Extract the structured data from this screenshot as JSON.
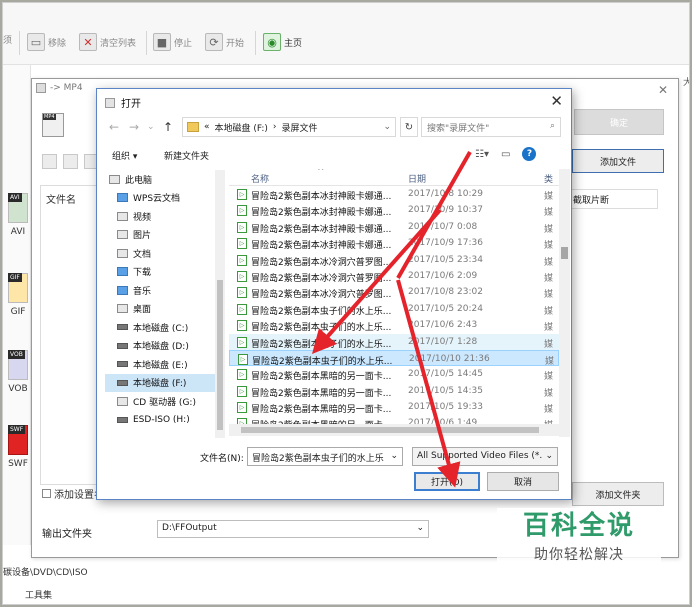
{
  "app": {
    "toolbar": {
      "left_fragment": "须",
      "remove": "移除",
      "clear_list": "清空列表",
      "stop": "停止",
      "start": "开始",
      "home": "主页"
    },
    "formats": [
      "AVI",
      "GIF",
      "VOB",
      "SWF"
    ],
    "format_tags": [
      "AVI",
      "GIF",
      "VOB",
      "SWF"
    ],
    "bottom_text": "碳设备\\DVD\\CD\\ISO",
    "toolbox": "工具集",
    "right_edge": "大"
  },
  "mp4_dialog": {
    "title": "-> MP4",
    "ok": "确定",
    "add_file": "添加文件",
    "file_name_col": "文件名",
    "clip": "截取片断",
    "add_settings": "添加设置名",
    "add_folder": "添加文件夹",
    "output_label": "输出文件夹",
    "output_path": "D:\\FFOutput"
  },
  "open_dialog": {
    "title": "打开",
    "breadcrumb": [
      "«",
      "本地磁盘 (F:)",
      "›",
      "录屏文件"
    ],
    "search_placeholder": "搜索\"录屏文件\"",
    "organize": "组织 ▾",
    "new_folder": "新建文件夹",
    "nav": [
      {
        "label": "此电脑",
        "icon": "pc-icon"
      },
      {
        "label": "WPS云文档",
        "icon": "cloud-icon"
      },
      {
        "label": "视频",
        "icon": "video-icon"
      },
      {
        "label": "图片",
        "icon": "picture-icon"
      },
      {
        "label": "文档",
        "icon": "document-icon"
      },
      {
        "label": "下载",
        "icon": "download-icon"
      },
      {
        "label": "音乐",
        "icon": "music-icon"
      },
      {
        "label": "桌面",
        "icon": "desktop-icon"
      },
      {
        "label": "本地磁盘 (C:)",
        "icon": "drive-icon"
      },
      {
        "label": "本地磁盘 (D:)",
        "icon": "drive-icon"
      },
      {
        "label": "本地磁盘 (E:)",
        "icon": "drive-icon"
      },
      {
        "label": "本地磁盘 (F:)",
        "icon": "drive-icon"
      },
      {
        "label": "CD 驱动器 (G:)",
        "icon": "cd-icon"
      },
      {
        "label": "ESD-ISO (H:)",
        "icon": "drive-icon"
      }
    ],
    "columns": {
      "name": "名称",
      "date": "日期",
      "type": "类"
    },
    "files": [
      {
        "name": "冒险岛2紫色副本冰封神殿卡娜通...",
        "date": "2017/10/8 10:29",
        "type": "媒"
      },
      {
        "name": "冒险岛2紫色副本冰封神殿卡娜通...",
        "date": "2017/10/9 10:37",
        "type": "媒"
      },
      {
        "name": "冒险岛2紫色副本冰封神殿卡娜通...",
        "date": "2017/10/7 0:08",
        "type": "媒"
      },
      {
        "name": "冒险岛2紫色副本冰封神殿卡娜通...",
        "date": "2017/10/9 17:36",
        "type": "媒"
      },
      {
        "name": "冒险岛2紫色副本冰冷洞穴普罗图...",
        "date": "2017/10/5 23:34",
        "type": "媒"
      },
      {
        "name": "冒险岛2紫色副本冰冷洞穴普罗图...",
        "date": "2017/10/6 2:09",
        "type": "媒"
      },
      {
        "name": "冒险岛2紫色副本冰冷洞穴普罗图...",
        "date": "2017/10/8 23:02",
        "type": "媒"
      },
      {
        "name": "冒险岛2紫色副本虫子们的水上乐...",
        "date": "2017/10/5 20:24",
        "type": "媒"
      },
      {
        "name": "冒险岛2紫色副本虫子们的水上乐...",
        "date": "2017/10/6 2:43",
        "type": "媒"
      },
      {
        "name": "冒险岛2紫色副本虫子们的水上乐...",
        "date": "2017/10/7 1:28",
        "type": "媒"
      },
      {
        "name": "冒险岛2紫色副本虫子们的水上乐...",
        "date": "2017/10/10 21:36",
        "type": "媒"
      },
      {
        "name": "冒险岛2紫色副本黑暗的另一面卡...",
        "date": "2017/10/5 14:45",
        "type": "媒"
      },
      {
        "name": "冒险岛2紫色副本黑暗的另一面卡...",
        "date": "2017/10/5 14:35",
        "type": "媒"
      },
      {
        "name": "冒险岛2紫色副本黑暗的另一面卡...",
        "date": "2017/10/5 19:33",
        "type": "媒"
      },
      {
        "name": "冒险岛2紫色副本黑暗的另一面卡...",
        "date": "2017/10/6 1:49",
        "type": "媒"
      }
    ],
    "filename_label": "文件名(N):",
    "filename_value": "冒险岛2紫色副本虫子们的水上乐",
    "filter": "All Supported Video Files (*.",
    "open": "打开(O)",
    "cancel": "取消"
  },
  "watermark": {
    "brand": "百科全说",
    "slogan": "助你轻松解决"
  }
}
